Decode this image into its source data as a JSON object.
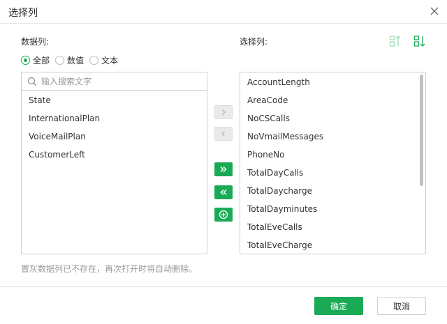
{
  "dialog": {
    "title": "选择列",
    "close_icon": "close-icon"
  },
  "data_columns": {
    "label": "数据列:",
    "filters": [
      {
        "label": "全部",
        "checked": true
      },
      {
        "label": "数值",
        "checked": false
      },
      {
        "label": "文本",
        "checked": false
      }
    ],
    "search_placeholder": "输入搜索文字",
    "items": [
      "State",
      "InternationalPlan",
      "VoiceMailPlan",
      "CustomerLeft"
    ]
  },
  "selected_columns": {
    "label": "选择列:",
    "sort_icons": [
      "sort-ascending-icon",
      "sort-descending-icon"
    ],
    "items": [
      "AccountLength",
      "AreaCode",
      "NoCSCalls",
      "NoVmailMessages",
      "PhoneNo",
      "TotalDayCalls",
      "TotalDaycharge",
      "TotalDayminutes",
      "TotalEveCalls",
      "TotalEveCharge"
    ]
  },
  "transfer_buttons": {
    "move_right_icon": "chevron-right-icon",
    "move_left_icon": "chevron-left-icon",
    "move_all_right_icon": "double-chevron-right-icon",
    "move_all_left_icon": "double-chevron-left-icon",
    "add_icon": "plus-circle-icon"
  },
  "hint": "置灰数据列已不存在，再次打开时将自动删除。",
  "footer": {
    "ok_label": "确定",
    "cancel_label": "取消"
  },
  "colors": {
    "accent": "#1aaa55",
    "disabled": "#eaeaea",
    "border": "#cfcfcf"
  }
}
